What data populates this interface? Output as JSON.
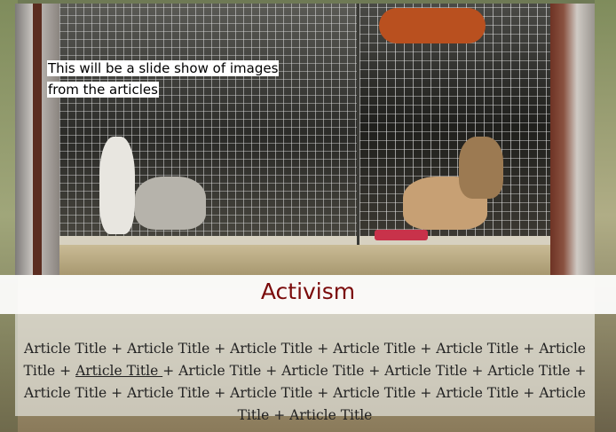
{
  "slideshow": {
    "caption_line1": "This will be a slide show of images",
    "caption_line2": "from the articles"
  },
  "section": {
    "title": "Activism",
    "title_color": "#7a0a0a"
  },
  "articles": {
    "separator": "+",
    "items": [
      {
        "label": "Article Title",
        "underlined": false
      },
      {
        "label": "Article Title",
        "underlined": false
      },
      {
        "label": "Article Title",
        "underlined": false
      },
      {
        "label": "Article Title",
        "underlined": false
      },
      {
        "label": "Article Title",
        "underlined": false
      },
      {
        "label": "Article Title",
        "underlined": false
      },
      {
        "label": "Article Title",
        "underlined": true
      },
      {
        "label": "Article Title",
        "underlined": false
      },
      {
        "label": "Article Title",
        "underlined": false
      },
      {
        "label": "Article Title",
        "underlined": false
      },
      {
        "label": "Article Title",
        "underlined": false
      },
      {
        "label": "Article Title",
        "underlined": false
      },
      {
        "label": "Article Title",
        "underlined": false
      },
      {
        "label": "Article Title",
        "underlined": false
      },
      {
        "label": "Article Title",
        "underlined": false
      },
      {
        "label": "Article Title",
        "underlined": false
      },
      {
        "label": "Article Title",
        "underlined": false
      },
      {
        "label": "Article Title",
        "underlined": false
      }
    ]
  }
}
